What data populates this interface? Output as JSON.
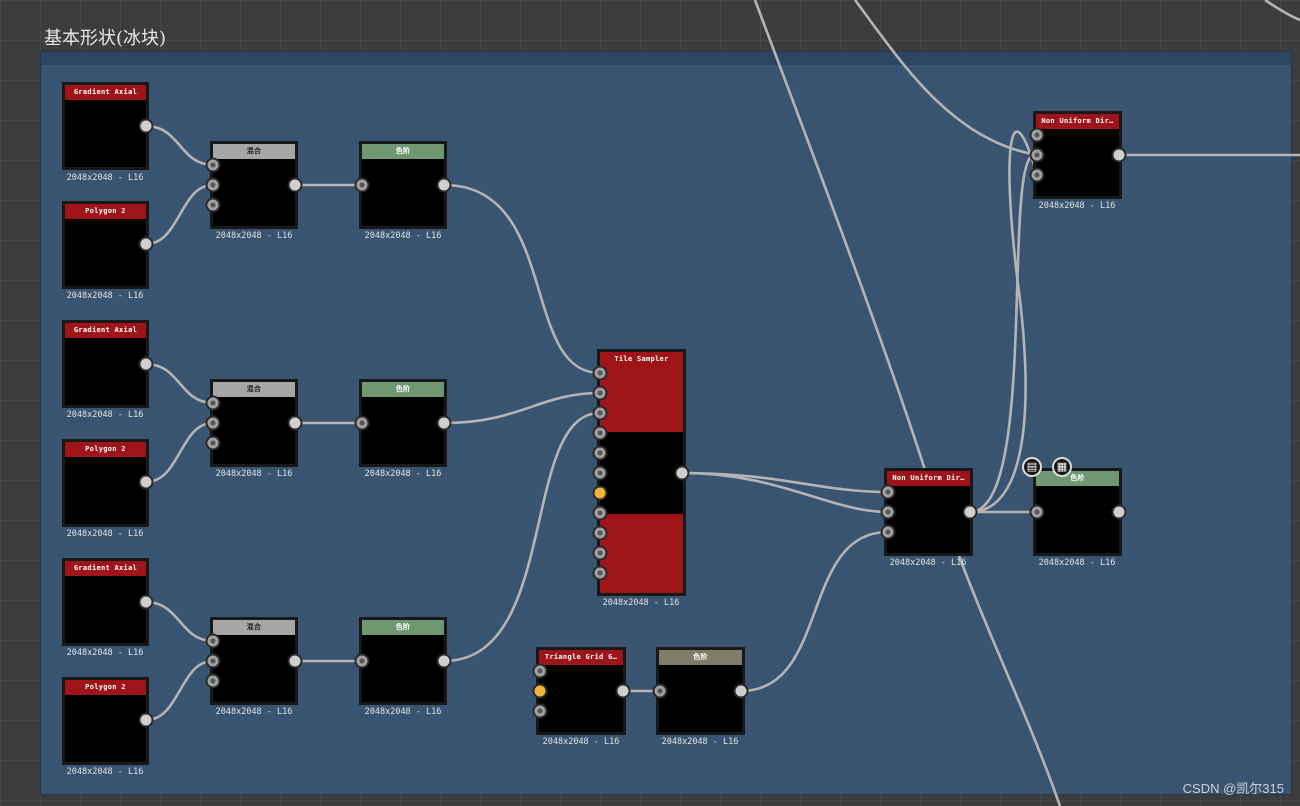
{
  "frame": {
    "title": "基本形状(冰块)"
  },
  "watermark": "CSDN @凯尔315",
  "colors": {
    "canvas": "#3c3c3c",
    "frame": "#385470",
    "node_red": "#9e1418",
    "node_green": "#6f9872",
    "wire": "#b4b4b4"
  },
  "nodes": {
    "grad_a": {
      "title": "Gradient Axial",
      "size": "2048x2048 - L16"
    },
    "poly_a": {
      "title": "Polygon 2",
      "size": "2048x2048 - L16"
    },
    "blend_a": {
      "title": "混合",
      "size": "2048x2048 - L16"
    },
    "level_a": {
      "title": "色阶",
      "size": "2048x2048 - L16"
    },
    "grad_b": {
      "title": "Gradient Axial",
      "size": "2048x2048 - L16"
    },
    "poly_b": {
      "title": "Polygon 2",
      "size": "2048x2048 - L16"
    },
    "blend_b": {
      "title": "混合",
      "size": "2048x2048 - L16"
    },
    "level_b": {
      "title": "色阶",
      "size": "2048x2048 - L16"
    },
    "grad_c": {
      "title": "Gradient Axial",
      "size": "2048x2048 - L16"
    },
    "poly_c": {
      "title": "Polygon 2",
      "size": "2048x2048 - L16"
    },
    "blend_c": {
      "title": "混合",
      "size": "2048x2048 - L16"
    },
    "level_c": {
      "title": "色阶",
      "size": "2048x2048 - L16"
    },
    "tile": {
      "title": "Tile Sampler",
      "size": "2048x2048 - L16"
    },
    "tri": {
      "title": "Triangle Grid G…",
      "size": "2048x2048 - L16"
    },
    "tri_level": {
      "title": "色阶",
      "size": "2048x2048 - L16"
    },
    "nud_mid": {
      "title": "Non Uniform Dir…",
      "size": "2048x2048 - L16"
    },
    "nud_top": {
      "title": "Non Uniform Dir…",
      "size": "2048x2048 - L16"
    },
    "level_out": {
      "title": "色阶",
      "size": "2048x2048 - L16"
    }
  },
  "icons": {
    "doc": "document-icon",
    "checker": "checker-icon"
  }
}
